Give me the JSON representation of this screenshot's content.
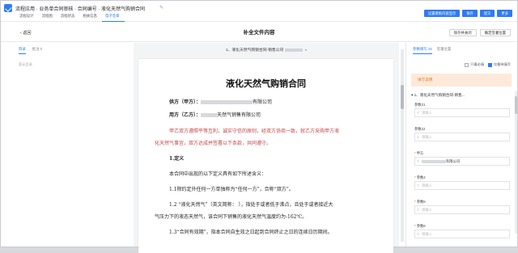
{
  "app": {
    "title": "流程应用 · 业务单合同审核 · 合同编号 · 液化天然气购销合同",
    "tabs": [
      {
        "label": "流程设计"
      },
      {
        "label": "流程图"
      },
      {
        "label": "流程状态"
      },
      {
        "label": "相关信息"
      },
      {
        "label": "电子签章"
      }
    ],
    "header_buttons": [
      {
        "label": "设置模板内容显示"
      },
      {
        "label": "保存"
      },
      {
        "label": "提交"
      },
      {
        "label": "更多"
      }
    ]
  },
  "subbar": {
    "back_label": "返回",
    "page_title": "补全文件内容",
    "actions": [
      {
        "label": "保存并关闭"
      },
      {
        "label": "确定签署位置"
      }
    ]
  },
  "left": {
    "tabs": [
      {
        "label": "目录"
      },
      {
        "label": "批注 0"
      }
    ],
    "empty_text": "暂无目录"
  },
  "doc": {
    "file_name": "1、液化天然气购销合同-销售公司",
    "title": "液化天然气购销合同",
    "seller_label": "供方（甲方）：",
    "seller_suffix": "有限公司",
    "buyer_label": "用方（乙方）：",
    "buyer_suffix": "天然气销售有限公司",
    "para1_l1": "甲乙双方遵照平等互利，诚实守信的原则，经双方协商一致，就乙方采购甲方液",
    "para1_l2": "化天然气事宜，双方达成并签署以下条款，共同遵守。",
    "sec1": "1.定义",
    "sec1_intro": "本合同中出现的以下定义具有如下所述含义：",
    "def1": "1.1除约定外任何一方单独称为“任何一方”，合称“双方”。",
    "def2_l1": "1.2 “液化天然气”（英文简称：      ），指处于或者低于沸点，且处于或者接近大",
    "def2_l2": "气压力下的液态天然气，该合同下销售的液化天然气温度约为-162℃。",
    "def3": "1.3“合同有效期”，指本合同自生效之日起到合同终止之日的连续日历期间。"
  },
  "right": {
    "tabs": [
      {
        "label": "参数填写 15"
      },
      {
        "label": "签署位置"
      }
    ],
    "checks": [
      {
        "label": "只看必填",
        "checked": false
      },
      {
        "label": "仅看待填写",
        "checked": true
      }
    ],
    "notice": "填写说明",
    "section_title": "1、液化天然气购销合同-销售...",
    "params": [
      {
        "label": "参数21",
        "required": false,
        "placeholder": "请输入",
        "value": ""
      },
      {
        "label": "参数22",
        "required": false,
        "placeholder": "请输入",
        "value": ""
      },
      {
        "label": "甲方",
        "required": true,
        "placeholder": "",
        "value": "有限公司"
      },
      {
        "label": "参数4",
        "required": true,
        "placeholder": "请输入",
        "value": ""
      },
      {
        "label": "参数5",
        "required": true,
        "placeholder": "请输入",
        "value": ""
      },
      {
        "label": "参数6",
        "required": true,
        "placeholder": "请输入",
        "value": ""
      }
    ]
  },
  "colors": {
    "accent": "#2f7bf5",
    "notice_bg": "#fde9d9",
    "notice_text": "#e07a2f"
  }
}
